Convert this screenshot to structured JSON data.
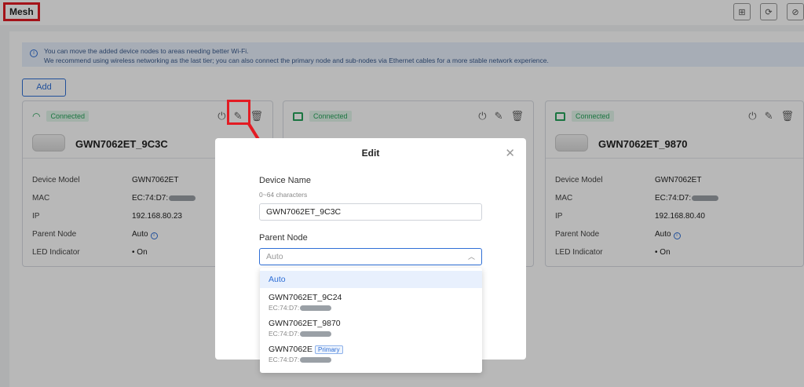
{
  "page": {
    "title": "Mesh"
  },
  "banner": {
    "line1": "You can move the added device nodes to areas needing better Wi-Fi.",
    "line2": "We recommend using wireless networking as the last tier; you can also connect the primary node and sub-nodes via Ethernet cables for a more stable network experience."
  },
  "toolbar": {
    "add_label": "Add"
  },
  "labels": {
    "device_model": "Device Model",
    "mac": "MAC",
    "ip": "IP",
    "parent_node": "Parent Node",
    "led": "LED Indicator"
  },
  "cards": [
    {
      "status": "Connected",
      "name": "GWN7062ET_9C3C",
      "model": "GWN7062ET",
      "mac": "EC:74:D7:",
      "ip": "192.168.80.23",
      "parent": "Auto",
      "led": "On"
    },
    {
      "status": "Connected"
    },
    {
      "status": "Connected",
      "name": "GWN7062ET_9870",
      "model": "GWN7062ET",
      "mac": "EC:74:D7:",
      "ip": "192.168.80.40",
      "parent": "Auto",
      "led": "On"
    }
  ],
  "modal": {
    "title": "Edit",
    "device_name_label": "Device Name",
    "device_name_hint": "0~64 characters",
    "device_name_value": "GWN7062ET_9C3C",
    "parent_node_label": "Parent Node",
    "parent_node_value": "Auto",
    "options": [
      {
        "label": "Auto"
      },
      {
        "label": "GWN7062ET_9C24",
        "mac": "EC:74:D7:"
      },
      {
        "label": "GWN7062ET_9870",
        "mac": "EC:74:D7:"
      },
      {
        "label": "GWN7062E",
        "mac": "EC:74:D7:",
        "tag": "Primary"
      }
    ]
  },
  "icons": {
    "top": [
      "topology-icon",
      "scan-icon",
      "block-icon"
    ],
    "card_actions": [
      "power-icon",
      "edit-icon",
      "delete-icon"
    ]
  },
  "colors": {
    "accent": "#2f6fd6",
    "connected": "#26a35a",
    "highlight": "#e31b23"
  }
}
